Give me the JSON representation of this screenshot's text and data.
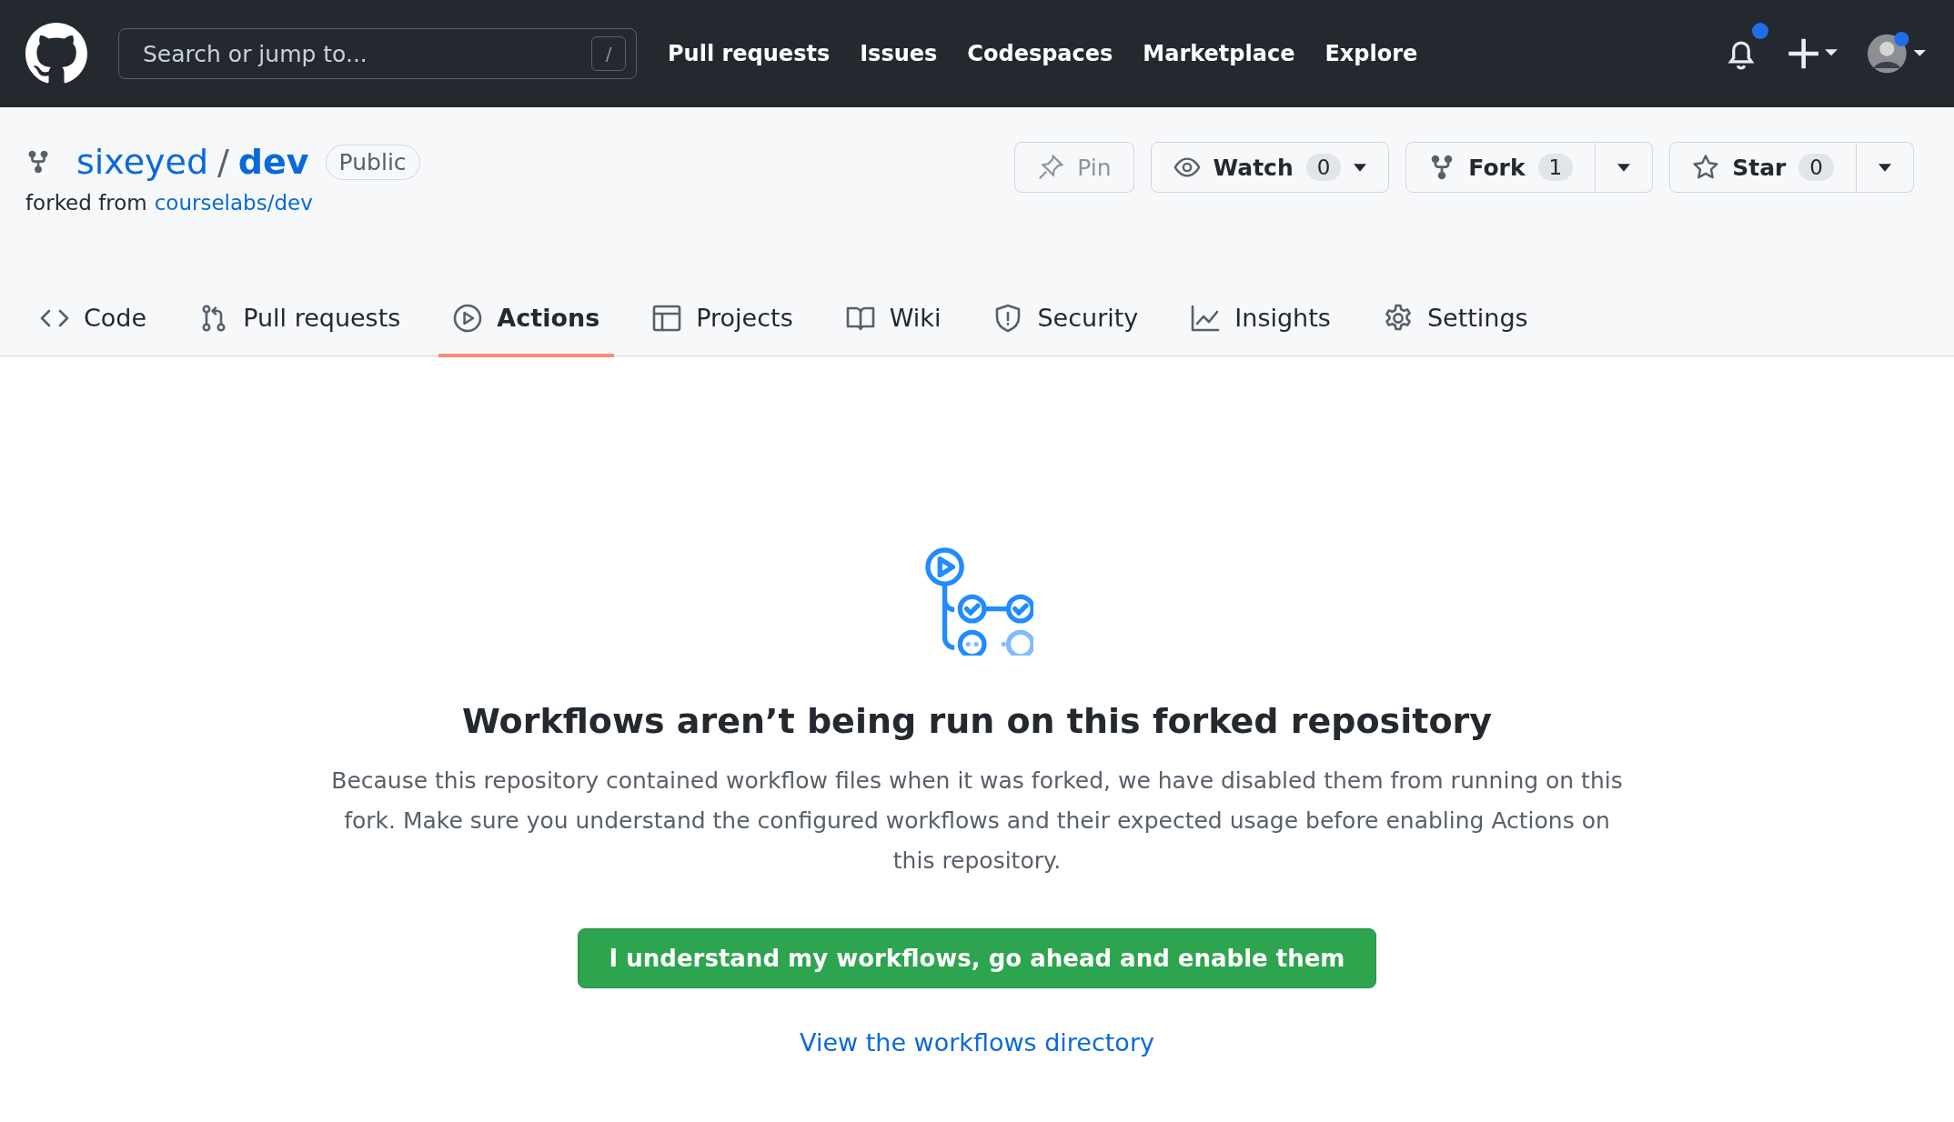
{
  "header": {
    "search": {
      "placeholder": "Search or jump to...",
      "shortcut": "/"
    },
    "nav": [
      "Pull requests",
      "Issues",
      "Codespaces",
      "Marketplace",
      "Explore"
    ],
    "notifications_unread": true
  },
  "repo": {
    "owner": "sixeyed",
    "separator": "/",
    "name": "dev",
    "visibility": "Public",
    "forked_from_label": "forked from",
    "forked_from": "courselabs/dev",
    "actions": [
      {
        "kind": "pin",
        "label": "Pin",
        "disabled": true
      },
      {
        "kind": "watch",
        "label": "Watch",
        "count": "0",
        "disabled": false
      },
      {
        "kind": "fork",
        "label": "Fork",
        "count": "1",
        "disabled": false
      },
      {
        "kind": "star",
        "label": "Star",
        "count": "0",
        "disabled": false
      }
    ]
  },
  "tabs": [
    {
      "kind": "code",
      "label": "Code",
      "selected": false
    },
    {
      "kind": "pr",
      "label": "Pull requests",
      "selected": false
    },
    {
      "kind": "play",
      "label": "Actions",
      "selected": true
    },
    {
      "kind": "table",
      "label": "Projects",
      "selected": false
    },
    {
      "kind": "book",
      "label": "Wiki",
      "selected": false
    },
    {
      "kind": "shield",
      "label": "Security",
      "selected": false
    },
    {
      "kind": "graph",
      "label": "Insights",
      "selected": false
    },
    {
      "kind": "gear",
      "label": "Settings",
      "selected": false
    }
  ],
  "notice": {
    "title": "Workflows aren’t being run on this forked repository",
    "body": "Because this repository contained workflow files when it was forked, we have disabled them from running on this fork. Make sure you understand the configured workflows and their expected usage before enabling Actions on this repository.",
    "button": "I understand my workflows, go ahead and enable them",
    "link": "View the workflows directory"
  }
}
